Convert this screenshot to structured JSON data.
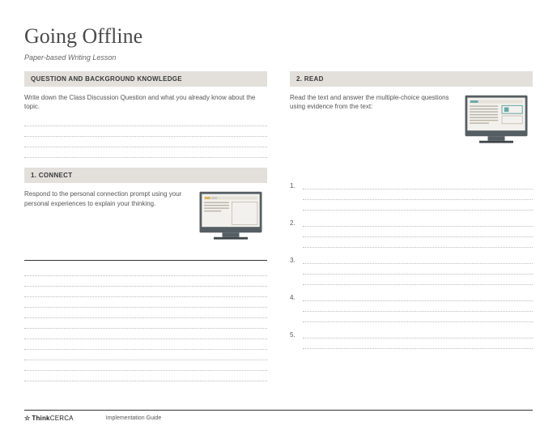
{
  "title": "Going Offline",
  "subtitle": "Paper-based Writing Lesson",
  "left": {
    "qbk_header": "QUESTION AND BACKGROUND KNOWLEDGE",
    "qbk_text": "Write down the Class Discussion Question and what you already know about the topic.",
    "connect_header": "1. CONNECT",
    "connect_text": "Respond to the personal connection prompt using your personal experiences to explain your thinking."
  },
  "right": {
    "read_header": "2. READ",
    "read_text": "Read the text and answer the multiple-choice questions using evidence from the text:",
    "numbers": [
      "1.",
      "2.",
      "3.",
      "4.",
      "5."
    ]
  },
  "footer": {
    "brand_bold": "Think",
    "brand_rest": "CERCA",
    "guide": "Implementation Guide"
  },
  "colors": {
    "section_bg": "#e3e0db",
    "monitor_frame": "#555e63",
    "monitor_screen": "#f3f1ed",
    "accent_yellow": "#d7b551",
    "accent_teal": "#6aa7a7"
  }
}
